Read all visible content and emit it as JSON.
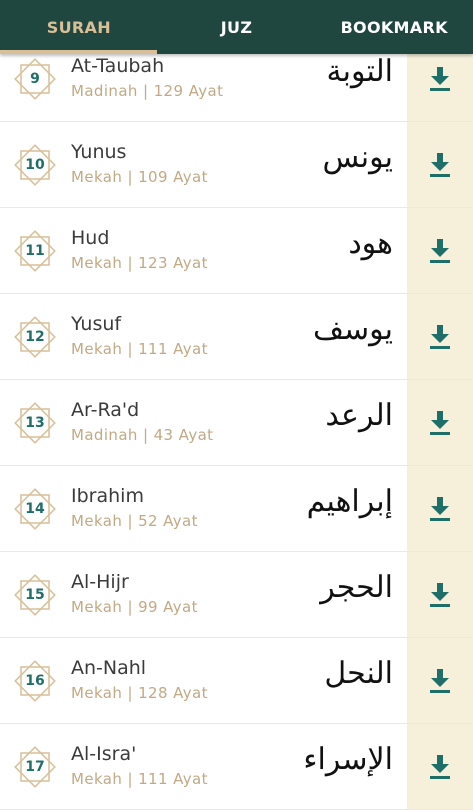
{
  "tabs": [
    {
      "label": "SURAH",
      "active": true
    },
    {
      "label": "JUZ",
      "active": false
    },
    {
      "label": "BOOKMARK",
      "active": false
    }
  ],
  "colors": {
    "topbar": "#1f4740",
    "accent": "#d8bf97",
    "download_bg": "#f6f0db",
    "number": "#1f6f69"
  },
  "surahs": [
    {
      "number": "9",
      "name": "At-Taubah",
      "meta": "Madinah | 129 Ayat",
      "arabic": "التوبة",
      "action_icon": "download-icon"
    },
    {
      "number": "10",
      "name": "Yunus",
      "meta": "Mekah | 109 Ayat",
      "arabic": "يونس",
      "action_icon": "download-icon"
    },
    {
      "number": "11",
      "name": "Hud",
      "meta": "Mekah | 123 Ayat",
      "arabic": "هود",
      "action_icon": "download-icon"
    },
    {
      "number": "12",
      "name": "Yusuf",
      "meta": "Mekah | 111 Ayat",
      "arabic": "يوسف",
      "action_icon": "download-icon"
    },
    {
      "number": "13",
      "name": "Ar-Ra'd",
      "meta": "Madinah | 43 Ayat",
      "arabic": "الرعد",
      "action_icon": "download-icon"
    },
    {
      "number": "14",
      "name": "Ibrahim",
      "meta": "Mekah | 52 Ayat",
      "arabic": "إبراهيم",
      "action_icon": "download-icon"
    },
    {
      "number": "15",
      "name": "Al-Hijr",
      "meta": "Mekah | 99 Ayat",
      "arabic": "الحجر",
      "action_icon": "download-icon"
    },
    {
      "number": "16",
      "name": "An-Nahl",
      "meta": "Mekah | 128 Ayat",
      "arabic": "النحل",
      "action_icon": "download-icon"
    },
    {
      "number": "17",
      "name": "Al-Isra'",
      "meta": "Mekah | 111 Ayat",
      "arabic": "الإسراء",
      "action_icon": "download-icon"
    }
  ]
}
